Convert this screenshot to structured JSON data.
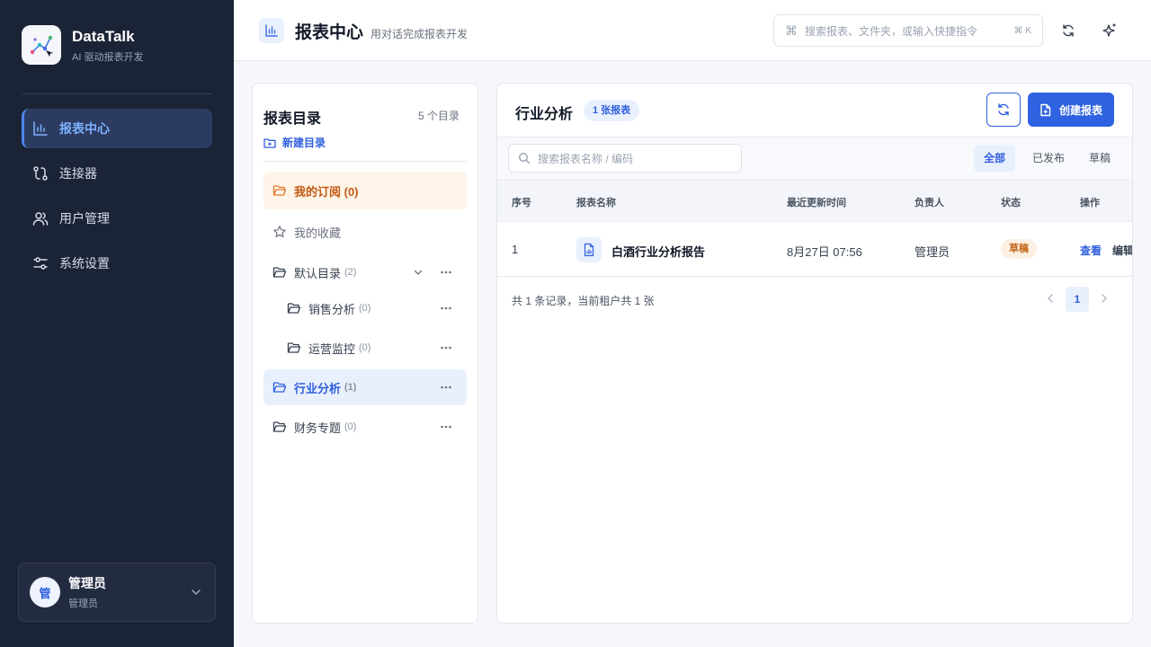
{
  "colors": {
    "sidebar_bg": "#1b2336",
    "accent": "#2f62e0",
    "subscribe": "#c25a13",
    "draft": "#c2661a"
  },
  "brand": {
    "name": "DataTalk",
    "subtitle": "AI 驱动报表开发"
  },
  "nav": {
    "items": [
      {
        "label": "报表中心",
        "icon": "bar-chart-icon",
        "active": true
      },
      {
        "label": "连接器",
        "icon": "connector-icon",
        "active": false
      },
      {
        "label": "用户管理",
        "icon": "users-icon",
        "active": false
      },
      {
        "label": "系统设置",
        "icon": "sliders-icon",
        "active": false
      }
    ]
  },
  "user": {
    "avatar": "管",
    "name": "管理员",
    "role": "管理员"
  },
  "header": {
    "title": "报表中心",
    "subtitle": "用对话完成报表开发",
    "search_placeholder": "搜索报表、文件夹，或输入快捷指令",
    "cmd_glyph": "⌘",
    "shortcut": "⌘ K"
  },
  "directory": {
    "title": "报表目录",
    "count": "5 个目录",
    "new_label": "新建目录",
    "subscribe": "我的订阅 (0)",
    "favorites": "我的收藏",
    "folders": [
      {
        "name": "默认目录",
        "count": "(2)"
      },
      {
        "name": "销售分析",
        "count": "(0)"
      },
      {
        "name": "运营监控",
        "count": "(0)"
      },
      {
        "name": "行业分析",
        "count": "(1)"
      },
      {
        "name": "财务专题",
        "count": "(0)"
      }
    ]
  },
  "reports": {
    "title": "行业分析",
    "badge": "1 张报表",
    "create_label": "创建报表",
    "search_placeholder": "搜索报表名称 / 编码",
    "filters": [
      "全部",
      "已发布",
      "草稿"
    ],
    "columns": [
      "序号",
      "报表名称",
      "最近更新时间",
      "负责人",
      "状态",
      "操作"
    ],
    "rows": [
      {
        "index": "1",
        "name": "白酒行业分析报告",
        "updated": "8月27日 07:56",
        "owner": "管理员",
        "status": "草稿",
        "view": "查看",
        "edit": "编辑"
      }
    ],
    "footer": "共 1 条记录，当前租户共 1 张",
    "page": "1"
  }
}
